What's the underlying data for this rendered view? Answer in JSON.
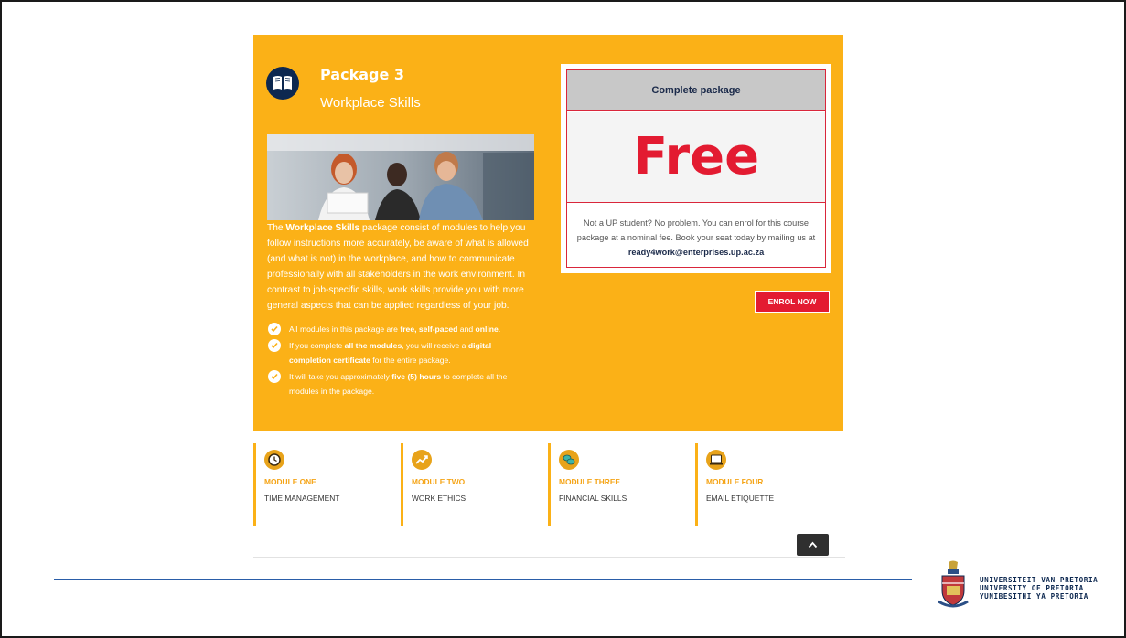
{
  "package": {
    "title": "Package 3",
    "subtitle": "Workplace Skills",
    "icon": "book-icon",
    "description_bold": "Workplace Skills",
    "description_pre": "The ",
    "description_post": " package consist of modules to help you follow instructions more accurately, be aware of what is allowed (and what is not) in the workplace, and how to communicate professionally with all stakeholders in the work environment. In contrast to job-specific skills, work skills provide you with more general aspects that can be applied regardless of your job.",
    "bullets": [
      {
        "t1": "All modules in this package are ",
        "b1": "free, self-paced",
        "t2": " and ",
        "b2": "online",
        "t3": "."
      },
      {
        "t1": "If you complete ",
        "b1": "all the modules",
        "t2": ", you will receive a ",
        "b2": "digital completion certificate",
        "t3": " for the entire package."
      },
      {
        "t1": "It will take you approximately ",
        "b1": "five (5) hours",
        "t2": " to complete all the modules in the package.",
        "b2": "",
        "t3": ""
      }
    ]
  },
  "pricing": {
    "header": "Complete package",
    "price": "Free",
    "note_pre": "Not a UP student? No problem. You can enrol for this course package at a nominal fee. Book your seat today by mailing us at ",
    "email": "ready4work@enterprises.up.ac.za"
  },
  "enrol_label": "ENROL NOW",
  "modules": [
    {
      "num": "MODULE ONE",
      "name": "TIME MANAGEMENT",
      "icon": "clock-icon"
    },
    {
      "num": "MODULE TWO",
      "name": "WORK ETHICS",
      "icon": "chart-icon"
    },
    {
      "num": "MODULE THREE",
      "name": "FINANCIAL SKILLS",
      "icon": "coins-icon"
    },
    {
      "num": "MODULE FOUR",
      "name": "EMAIL ETIQUETTE",
      "icon": "laptop-icon"
    }
  ],
  "university": {
    "line1": "UNIVERSITEIT VAN PRETORIA",
    "line2": "UNIVERSITY OF PRETORIA",
    "line3": "YUNIBESITHI YA PRETORIA"
  },
  "colors": {
    "panel": "#fbb117",
    "price_red": "#e31b31",
    "navy": "#0d2850",
    "rule_blue": "#2a5da8"
  }
}
